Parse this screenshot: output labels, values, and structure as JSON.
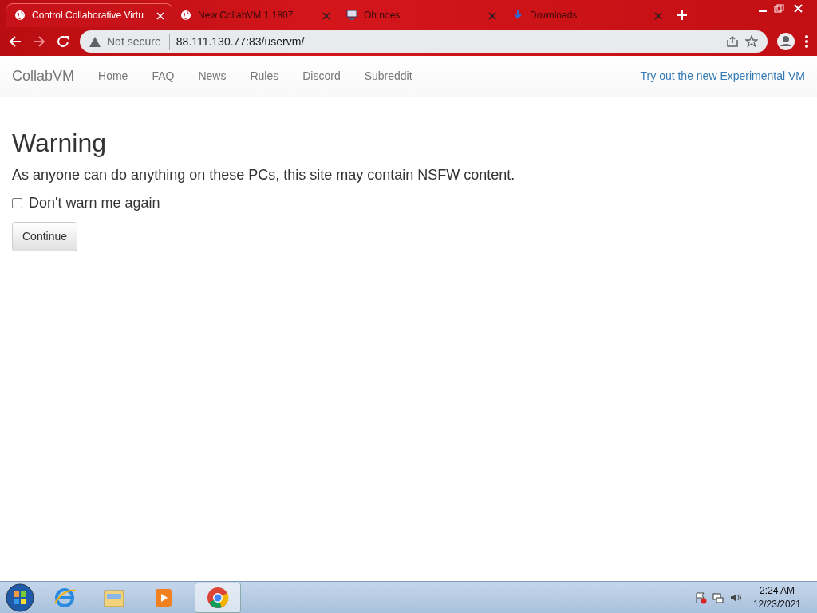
{
  "browser": {
    "tabs": [
      {
        "title": "Control Collaborative Virtu",
        "kind": "globe",
        "selected": true
      },
      {
        "title": "New CollabVM 1.1807",
        "kind": "globe",
        "selected": false
      },
      {
        "title": "Oh noes",
        "kind": "computer",
        "selected": false
      },
      {
        "title": "Downloads",
        "kind": "download",
        "selected": false
      }
    ],
    "security": "Not secure",
    "url": "88.111.130.77:83/uservm/"
  },
  "navbar": {
    "brand": "CollabVM",
    "links": [
      "Home",
      "FAQ",
      "News",
      "Rules",
      "Discord",
      "Subreddit"
    ],
    "right_link": "Try out the new Experimental VM"
  },
  "warning": {
    "title": "Warning",
    "message": "As anyone can do anything on these PCs, this site may contain NSFW content.",
    "checkbox": {
      "label": "Don't warn me again",
      "checked": false
    },
    "button": "Continue"
  },
  "taskbar": {
    "apps": [
      {
        "kind": "ie",
        "active": false
      },
      {
        "kind": "explorer",
        "active": false
      },
      {
        "kind": "media",
        "active": false
      },
      {
        "kind": "chrome",
        "active": true
      }
    ],
    "time": "2:24 AM",
    "date": "12/23/2021"
  }
}
